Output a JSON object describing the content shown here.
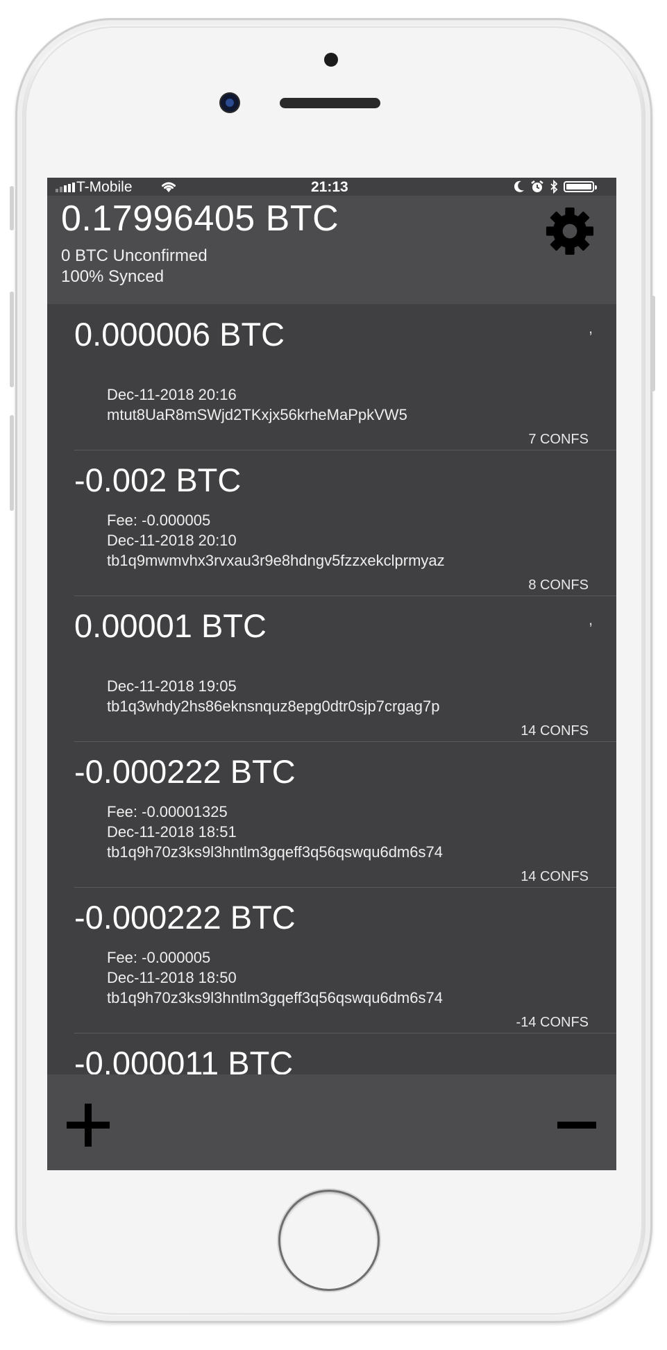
{
  "status_bar": {
    "carrier": "T-Mobile",
    "time": "21:13",
    "icons": [
      "signal-icon",
      "wifi-icon",
      "moon-icon",
      "alarm-icon",
      "bluetooth-icon",
      "battery-icon"
    ]
  },
  "wallet": {
    "balance": "0.17996405 BTC",
    "unconfirmed": "0 BTC Unconfirmed",
    "synced": "100% Synced",
    "settings_icon": "gear-icon"
  },
  "transactions": [
    {
      "amount": "0.000006 BTC",
      "mark": ",",
      "fee": "",
      "date": "Dec-11-2018 20:16",
      "address": "mtut8UaR8mSWjd2TKxjx56krheMaPpkVW5",
      "confs": "7 CONFS"
    },
    {
      "amount": "-0.002 BTC",
      "mark": "",
      "fee": "Fee: -0.000005",
      "date": "Dec-11-2018 20:10",
      "address": "tb1q9mwmvhx3rvxau3r9e8hdngv5fzzxekclprmyaz",
      "confs": "8 CONFS"
    },
    {
      "amount": "0.00001 BTC",
      "mark": ",",
      "fee": "",
      "date": "Dec-11-2018 19:05",
      "address": "tb1q3whdy2hs86eknsnquz8epg0dtr0sjp7crgag7p",
      "confs": "14 CONFS"
    },
    {
      "amount": "-0.000222 BTC",
      "mark": "",
      "fee": "Fee: -0.00001325",
      "date": "Dec-11-2018 18:51",
      "address": "tb1q9h70z3ks9l3hntlm3gqeff3q56qswqu6dm6s74",
      "confs": "14 CONFS"
    },
    {
      "amount": "-0.000222 BTC",
      "mark": "",
      "fee": "Fee: -0.000005",
      "date": "Dec-11-2018 18:50",
      "address": "tb1q9h70z3ks9l3hntlm3gqeff3q56qswqu6dm6s74",
      "confs": "-14 CONFS"
    },
    {
      "amount": "-0.000011 BTC",
      "mark": "",
      "fee": "",
      "date": "",
      "address": "",
      "confs": ""
    }
  ],
  "toolbar": {
    "add_icon": "plus-icon",
    "remove_icon": "minus-icon"
  },
  "colors": {
    "screen_bg": "#404042",
    "header_bg": "#4c4c4e",
    "text": "#ffffff",
    "button_glyph": "#000000"
  }
}
